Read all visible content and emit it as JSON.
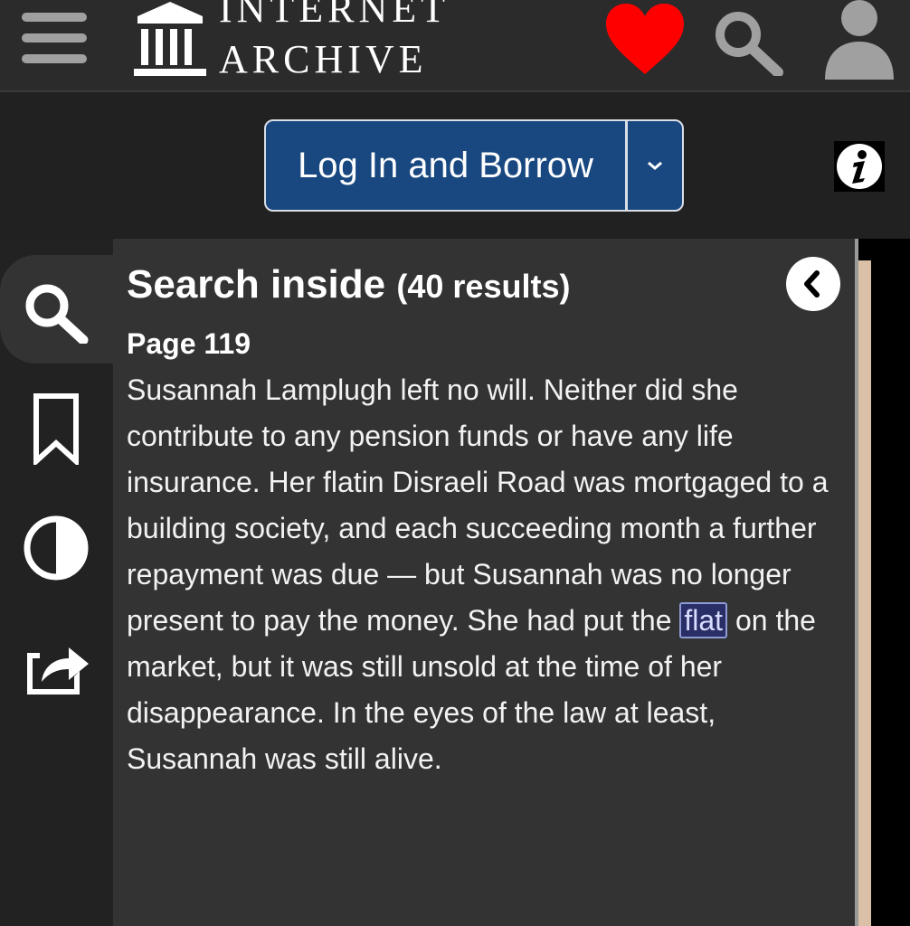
{
  "header": {
    "logo_line1": "INTERNET",
    "logo_line2": "ARCHIVE",
    "icons": [
      "hamburger-menu-icon",
      "archive-logo-icon",
      "heart-icon",
      "search-icon",
      "user-icon"
    ]
  },
  "borrow": {
    "button_label": "Log In and Borrow",
    "dropdown_icon": "chevron-down-icon",
    "info_icon": "info-icon"
  },
  "left_nav": {
    "items": [
      "search-icon",
      "bookmark-icon",
      "contrast-icon",
      "share-icon"
    ],
    "active": "search-icon"
  },
  "search_panel": {
    "title": "Search inside",
    "count": "(40 results)",
    "result": {
      "page": "Page 119",
      "text_before": "Susannah Lamplugh left no will. Neither did she contribute to any pension funds or have any life insurance. Her flatin Disraeli Road was mortgaged to a building society, and each succeeding month a further repayment was due — but Susannah was no longer present to pay the money. She had put the ",
      "highlight": "flat",
      "text_after": " on the market, but it was still unsold at the time of her disappearance. In the eyes of the law at least, Susannah was still alive."
    }
  },
  "colors": {
    "background": "#222222",
    "panel": "#333333",
    "borrow_button": "#194880",
    "heart": "#ff0000",
    "highlight_border": "#8c9ad6"
  }
}
